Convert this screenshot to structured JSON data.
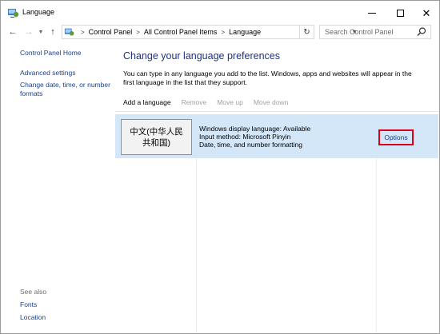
{
  "window": {
    "title": "Language",
    "icons": {
      "app": "control-panel-icon",
      "minimize": "minimize-icon",
      "maximize": "maximize-icon",
      "close": "close-icon"
    }
  },
  "address": {
    "breadcrumbs": [
      "Control Panel",
      "All Control Panel Items",
      "Language"
    ],
    "search_placeholder": "Search Control Panel"
  },
  "sidebar": {
    "links": [
      "Control Panel Home",
      "Advanced settings",
      "Change date, time, or number formats"
    ],
    "see_also_label": "See also",
    "see_also_links": [
      "Fonts",
      "Location"
    ]
  },
  "main": {
    "heading": "Change your language preferences",
    "description": "You can type in any language you add to the list. Windows, apps and websites will appear in the first language in the list that they support.",
    "toolbar": {
      "add": "Add a language",
      "remove": "Remove",
      "move_up": "Move up",
      "move_down": "Move down"
    },
    "language": {
      "name": "中文(中华人民共和国)",
      "details": [
        "Windows display language: Available",
        "Input method: Microsoft Pinyin",
        "Date, time, and number formatting"
      ],
      "options_label": "Options"
    }
  },
  "colors": {
    "link": "#1a3f8e",
    "heading": "#1e3287",
    "selected_row": "#d3e7f8",
    "highlight_box": "#d9001b"
  }
}
